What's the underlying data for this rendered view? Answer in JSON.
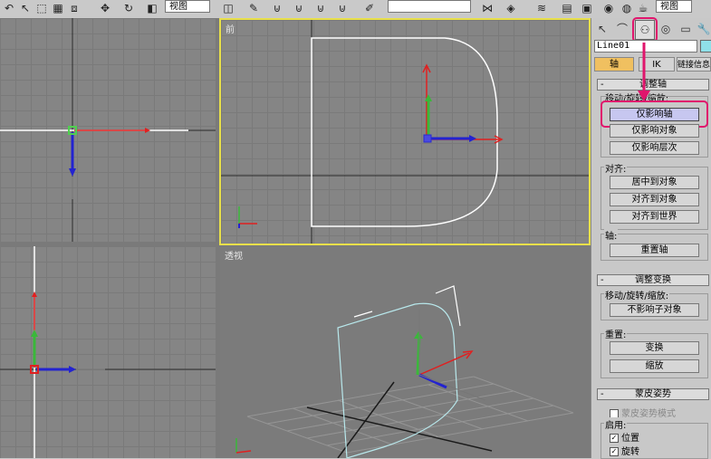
{
  "toolbar": {
    "view_dropdown_1": "视图",
    "view_dropdown_2": "视图"
  },
  "viewports": {
    "front_label": "前",
    "perspective_label": "透视"
  },
  "panel": {
    "object_name": "Line01",
    "tabs": {
      "pivot": "轴",
      "ik": "IK",
      "link_info": "链接信息"
    },
    "adjust_pivot": {
      "title": "调整轴",
      "move_rotate_scale_label": "移动/旋转/缩放:",
      "affect_pivot_only": "仅影响轴",
      "affect_object_only": "仅影响对象",
      "affect_hierarchy_only": "仅影响层次",
      "alignment_label": "对齐:",
      "center_to_object": "居中到对象",
      "align_to_object": "对齐到对象",
      "align_to_world": "对齐到世界",
      "pivot_label": "轴:",
      "reset_pivot": "重置轴"
    },
    "adjust_transform": {
      "title": "调整变换",
      "move_rotate_scale_label": "移动/旋转/缩放:",
      "dont_affect_children": "不影响子对象",
      "reset_label": "重置:",
      "transform": "变换",
      "scale": "缩放"
    },
    "skin_pose": {
      "title": "蒙皮姿势",
      "skin_pose_mode": "蒙皮姿势模式",
      "enable_label": "启用:",
      "position": "位置",
      "rotation": "旋转"
    }
  },
  "colors": {
    "highlight": "#e0156c",
    "active_viewport_border": "#e8e04a",
    "spline": "#ffffff"
  }
}
